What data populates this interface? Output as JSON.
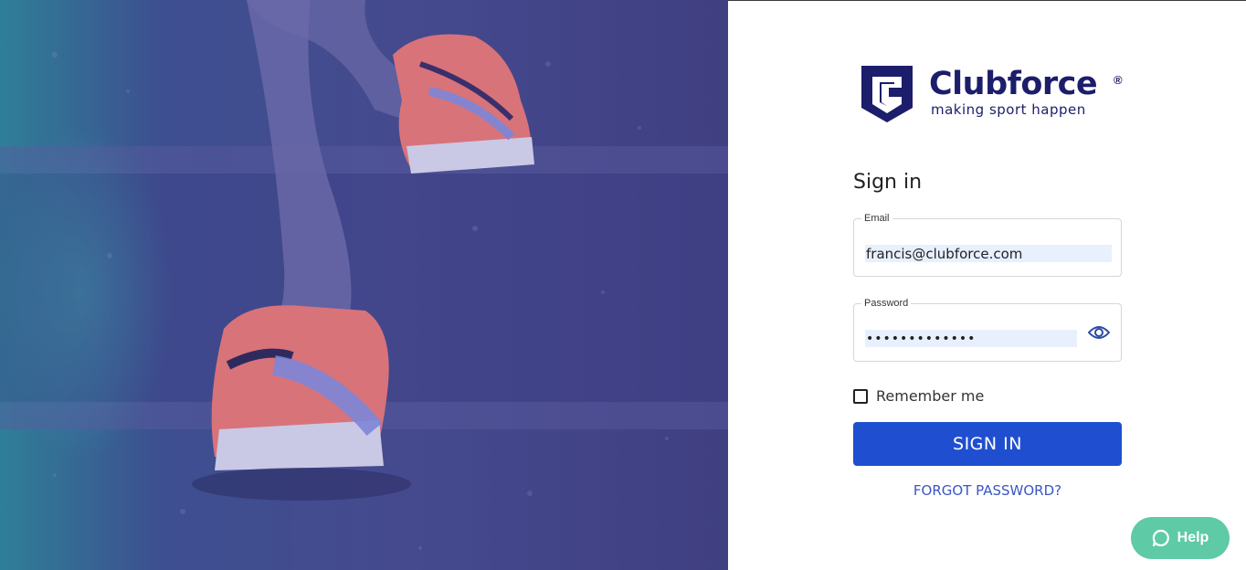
{
  "brand": {
    "name": "Clubforce",
    "registered_mark": "®",
    "tagline": "making sport happen",
    "color": "#1c1d6b"
  },
  "form": {
    "title": "Sign in",
    "email": {
      "label": "Email",
      "value": "francis@clubforce.com"
    },
    "password": {
      "label": "Password",
      "value": "•••••••••••••",
      "toggle_icon": "eye-icon"
    },
    "remember_me": {
      "label": "Remember me",
      "checked": false
    },
    "submit_label": "SIGN IN",
    "forgot_label": "FORGOT PASSWORD?"
  },
  "help": {
    "label": "Help",
    "icon": "chat-bubble-icon"
  },
  "colors": {
    "primary_button": "#1f4fd0",
    "link": "#3a56c4",
    "help_button": "#5fcaa6",
    "hero_overlay": "#454a8e"
  }
}
